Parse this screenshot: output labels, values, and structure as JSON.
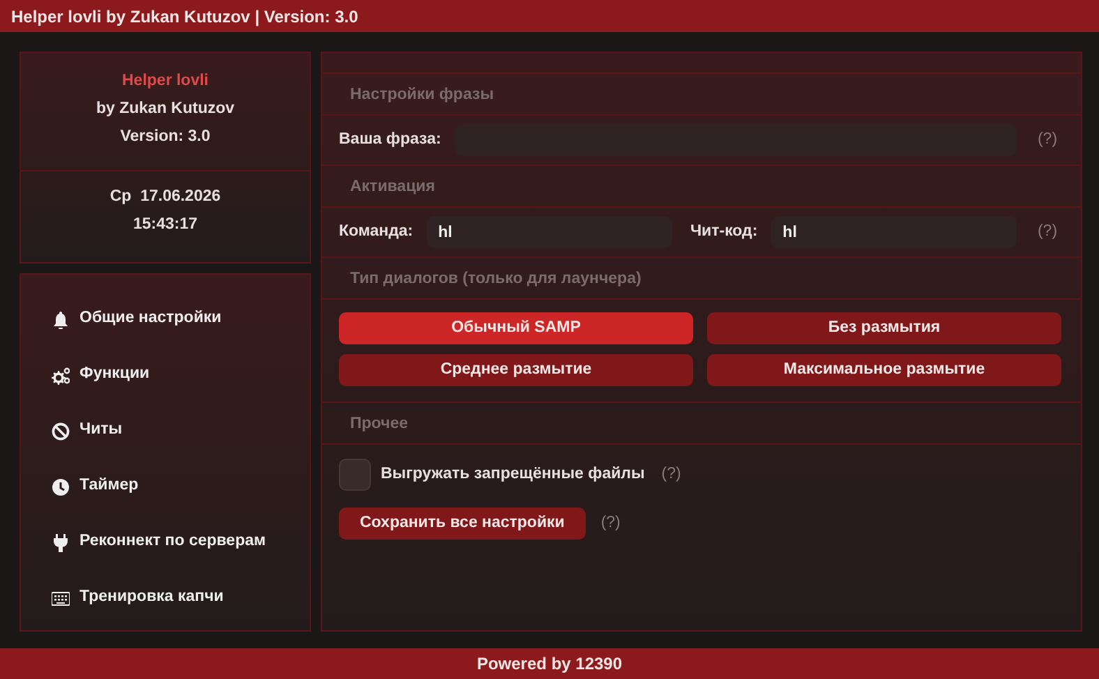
{
  "window": {
    "title": "Helper lovli by Zukan Kutuzov | Version: 3.0"
  },
  "info": {
    "name": "Helper lovli",
    "author": "by Zukan Kutuzov",
    "version": "Version: 3.0",
    "date": "Ср  17.06.2026",
    "time": "15:43:17"
  },
  "menu": [
    {
      "label": "Общие настройки"
    },
    {
      "label": "Функции"
    },
    {
      "label": "Читы"
    },
    {
      "label": "Таймер"
    },
    {
      "label": "Реконнект по серверам"
    },
    {
      "label": "Тренировка капчи"
    }
  ],
  "phrase": {
    "title": "Настройки фразы",
    "label": "Ваша фраза:",
    "hint": "(?)"
  },
  "activation": {
    "title": "Активация",
    "command": {
      "label": "Команда:",
      "value": "hl"
    },
    "cheat": {
      "label": "Чит-код:",
      "value": "hl"
    },
    "hint": "(?)"
  },
  "dialogs": {
    "title": "Тип диалогов (только для лаунчера)",
    "options": [
      {
        "label": "Обычный SAMP",
        "selected": true
      },
      {
        "label": "Без размытия",
        "selected": false
      },
      {
        "label": "Среднее размытие",
        "selected": false
      },
      {
        "label": "Максимальное размытие",
        "selected": false
      }
    ]
  },
  "other": {
    "title": "Прочее",
    "checkbox": {
      "label": "Выгружать запрещённые файлы",
      "checked": false,
      "hint": "(?)"
    },
    "save": {
      "label": "Сохранить все настройки",
      "hint": "(?)"
    }
  },
  "footer": "Powered by 12390"
}
